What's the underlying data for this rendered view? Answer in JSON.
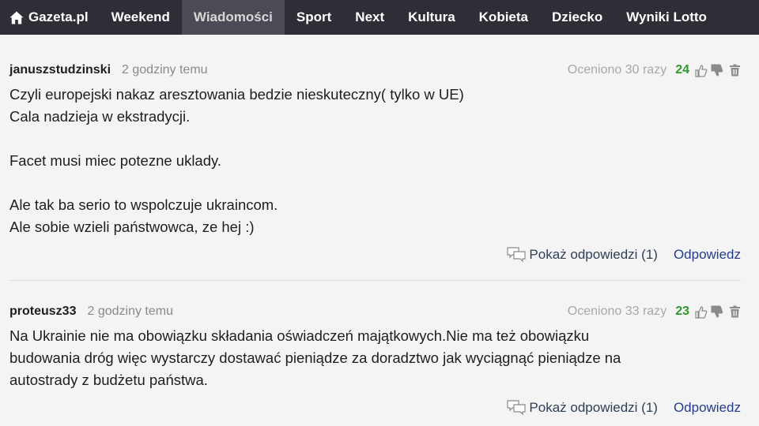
{
  "nav": {
    "home_label": "Gazeta.pl",
    "items": [
      "Weekend",
      "Wiadomości",
      "Sport",
      "Next",
      "Kultura",
      "Kobieta",
      "Dziecko",
      "Wyniki Lotto"
    ],
    "active": "Wiadomości"
  },
  "comments": [
    {
      "author": "januszstudzinski",
      "time": "2 godziny temu",
      "rated": "Oceniono 30 razy",
      "score": "24",
      "lines": [
        "Czyli europejski nakaz aresztowania bedzie nieskuteczny( tylko w UE)",
        "Cala nadzieja w ekstradycji.",
        "",
        "Facet musi miec potezne uklady.",
        "",
        "Ale tak ba serio to wspolczuje ukraincom.",
        "Ale sobie wzieli państwowca, ze hej :)"
      ],
      "show_replies": "Pokaż odpowiedzi (1)",
      "reply": "Odpowiedz"
    },
    {
      "author": "proteusz33",
      "time": "2 godziny temu",
      "rated": "Oceniono 33 razy",
      "score": "23",
      "lines": [
        "Na Ukrainie nie ma obowiązku składania oświadczeń majątkowych.Nie ma też obowiązku",
        "budowania dróg więc wystarczy dostawać pieniądze za doradztwo jak wyciągnąć pieniądze na",
        "autostrady z budżetu państwa."
      ],
      "show_replies": "Pokaż odpowiedzi (1)",
      "reply": "Odpowiedz"
    }
  ],
  "icons": {
    "home": "home-icon",
    "thumbs_up": "thumbs-up-icon",
    "thumbs_down": "thumbs-down-icon",
    "trash": "trash-icon",
    "replies": "speech-bubbles-icon"
  },
  "colors": {
    "nav_bg": "#2e2e36",
    "nav_active_bg": "#4b4b55",
    "score_green": "#2e9a2e",
    "link_blue": "#253c8a",
    "page_bg": "#f4f4f4"
  }
}
